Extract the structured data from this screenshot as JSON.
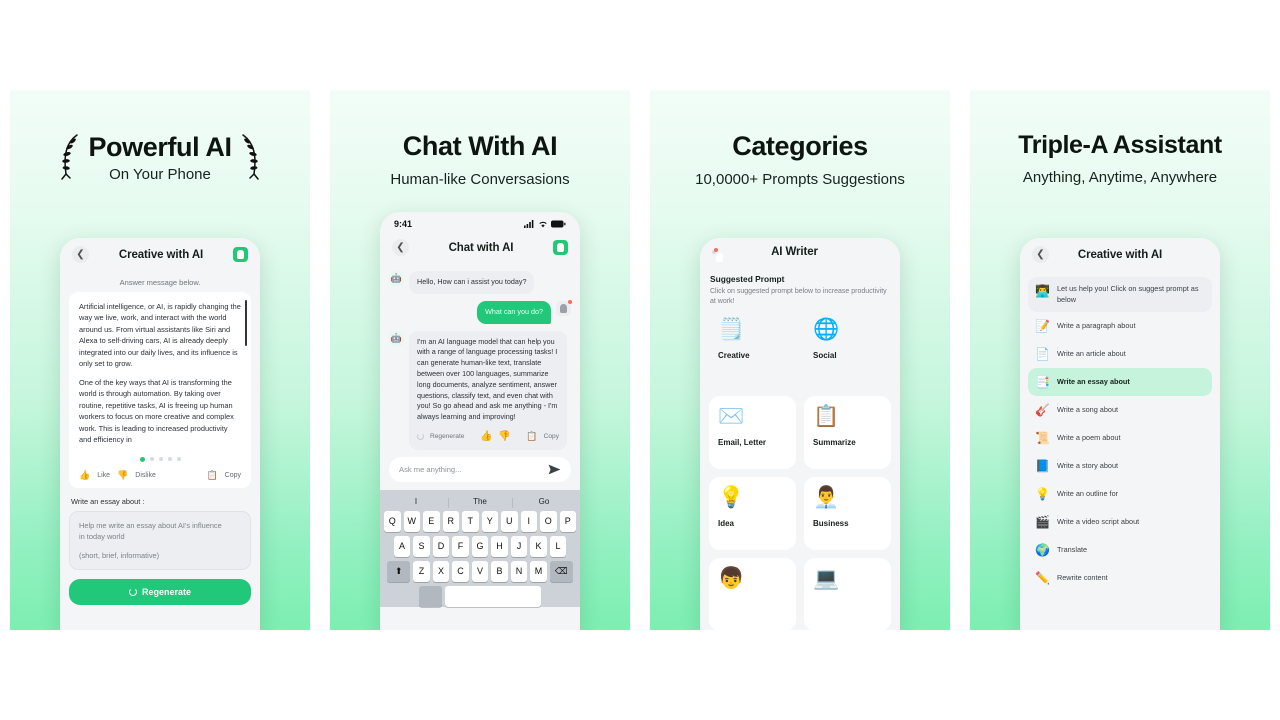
{
  "panels": [
    {
      "title": "Powerful AI",
      "subtitle": "On Your Phone",
      "nav": {
        "title": "Creative with AI",
        "back_icon": "chevron-left-icon",
        "bot_icon": "bot-badge-icon"
      },
      "answer_label": "Answer message below.",
      "answer_paragraphs": [
        "Artificial intelligence, or AI, is rapidly changing the way we live, work, and interact with the world around us. From virtual assistants like Siri and Alexa to self-driving cars, AI is already deeply integrated into our daily lives, and its influence is only set to grow.",
        "One of the key ways that AI is transforming the world is through automation. By taking over routine, repetitive tasks, AI is freeing up human workers to focus on more creative and complex work. This is leading to increased productivity and efficiency in"
      ],
      "actions": {
        "like": "Like",
        "dislike": "Dislike",
        "copy": "Copy"
      },
      "prompt_label": "Write an essay about :",
      "prompt_value_line1": "Help me write an essay about AI's influence",
      "prompt_value_line2": "in today world",
      "prompt_value_line3": "(short, brief, informative)",
      "regenerate": "Regenerate"
    },
    {
      "title": "Chat With AI",
      "subtitle": "Human-like Conversasions",
      "status": {
        "time": "9:41",
        "signal_icon": "cellular-signal-icon",
        "wifi_icon": "wifi-icon",
        "battery_icon": "battery-icon"
      },
      "nav": {
        "title": "Chat with AI",
        "back_icon": "chevron-left-icon",
        "bot_icon": "bot-badge-icon"
      },
      "messages": [
        {
          "from": "bot",
          "text": "Hello, How can i assist you today?"
        },
        {
          "from": "user",
          "text": "What can you do?"
        },
        {
          "from": "bot",
          "text": "I'm an AI language model that can help you with a range of language processing tasks! I can generate human-like text, translate between over 100 languages, summarize long documents, analyze sentiment, answer questions, classify text, and even chat with you! So go ahead and ask me anything - I'm always learning and improving!"
        }
      ],
      "msg_actions": {
        "regenerate": "Regenerate",
        "copy": "Copy"
      },
      "input_placeholder": "Ask me anything...",
      "send_icon": "send-icon",
      "keyboard": {
        "predictions": [
          "I",
          "The",
          "Go"
        ],
        "row1": [
          "Q",
          "W",
          "E",
          "R",
          "T",
          "Y",
          "U",
          "I",
          "O",
          "P"
        ],
        "row2": [
          "A",
          "S",
          "D",
          "F",
          "G",
          "H",
          "J",
          "K",
          "L"
        ],
        "row3": [
          "Z",
          "X",
          "C",
          "V",
          "B",
          "N",
          "M"
        ],
        "shift_icon": "shift-icon",
        "backspace_icon": "backspace-icon"
      }
    },
    {
      "title": "Categories",
      "subtitle": "10,0000+ Prompts Suggestions",
      "nav": {
        "title": "AI Writer",
        "bot_icon": "bot-badge-icon"
      },
      "section_title": "Suggested Prompt",
      "section_desc": "Click on suggested prompt below to increase productivity at work!",
      "categories": [
        {
          "name": "Creative",
          "emoji": "🗒️"
        },
        {
          "name": "Social",
          "emoji": "🌐"
        },
        {
          "name": "Email, Letter",
          "emoji": "✉️"
        },
        {
          "name": "Summarize",
          "emoji": "📋"
        },
        {
          "name": "Idea",
          "emoji": "💡"
        },
        {
          "name": "Business",
          "emoji": "👨‍💼"
        },
        {
          "name": "",
          "emoji": "👦"
        },
        {
          "name": "",
          "emoji": "💻"
        }
      ]
    },
    {
      "title": "Triple-A Assistant",
      "subtitle": "Anything, Anytime, Anywhere",
      "nav": {
        "title": "Creative with AI",
        "back_icon": "chevron-left-icon"
      },
      "hint": "Let us help you! Click on suggest prompt as below",
      "hint_emoji": "👨‍💻",
      "prompts": [
        {
          "label": "Write a paragraph about",
          "emoji": "📝",
          "active": false
        },
        {
          "label": "Write an article about",
          "emoji": "📄",
          "active": false
        },
        {
          "label": "Write an essay about",
          "emoji": "📑",
          "active": true
        },
        {
          "label": "Write a song about",
          "emoji": "🎸",
          "active": false
        },
        {
          "label": "Write a poem about",
          "emoji": "📜",
          "active": false
        },
        {
          "label": "Write a story about",
          "emoji": "📘",
          "active": false
        },
        {
          "label": "Write an outline for",
          "emoji": "💡",
          "active": false
        },
        {
          "label": "Write a video script about",
          "emoji": "🎬",
          "active": false
        },
        {
          "label": "Translate",
          "emoji": "🌍",
          "active": false
        },
        {
          "label": "Rewrite content",
          "emoji": "✏️",
          "active": false
        }
      ]
    }
  ],
  "colors": {
    "accent": "#22c87a",
    "gradient_top": "#f2fdf8",
    "gradient_bottom": "#7cefb1"
  }
}
